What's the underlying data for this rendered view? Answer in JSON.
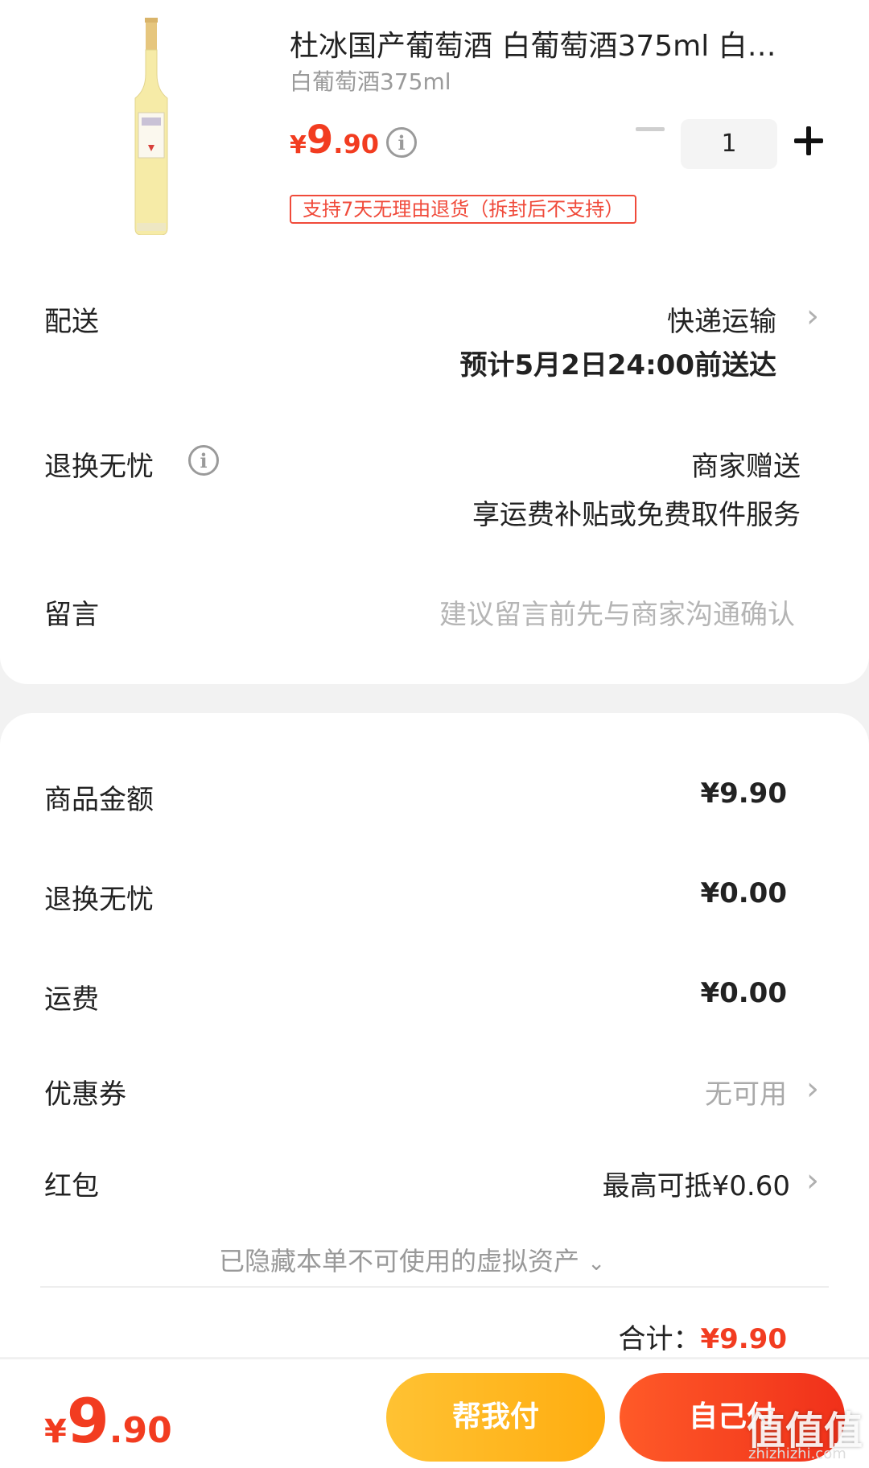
{
  "product": {
    "title": "杜冰国产葡萄酒 白葡萄酒375ml 白…",
    "spec": "白葡萄酒375ml",
    "price_currency": "¥",
    "price_int": "9",
    "price_dec": ".90",
    "quantity": "1",
    "return_tag": "支持7天无理由退货（拆封后不支持）"
  },
  "delivery": {
    "label": "配送",
    "method": "快递运输",
    "eta": "预计5月2日24:00前送达"
  },
  "return_service": {
    "label": "退换无忧",
    "value": "商家赠送",
    "detail": "享运费补贴或免费取件服务"
  },
  "message": {
    "label": "留言",
    "placeholder": "建议留言前先与商家沟通确认"
  },
  "summary": {
    "goods_label": "商品金额",
    "goods_value": "¥9.90",
    "return_label": "退换无忧",
    "return_value": "¥0.00",
    "shipping_label": "运费",
    "shipping_value": "¥0.00",
    "coupon_label": "优惠券",
    "coupon_value": "无可用",
    "redpacket_label": "红包",
    "redpacket_value": "最高可抵¥0.60",
    "hidden_assets": "已隐藏本单不可使用的虚拟资产",
    "total_label": "合计：",
    "total_value": "¥9.90"
  },
  "bottom": {
    "price_currency": "¥",
    "price_int": "9",
    "price_dec": ".90",
    "help_pay": "帮我付",
    "self_pay": "自己付",
    "watermark": "值值值",
    "watermark_url": "zhizhizhi.com"
  },
  "colors": {
    "accent": "#f23c20",
    "help_button": "#ffb31a",
    "self_button": "#f33b1e"
  }
}
